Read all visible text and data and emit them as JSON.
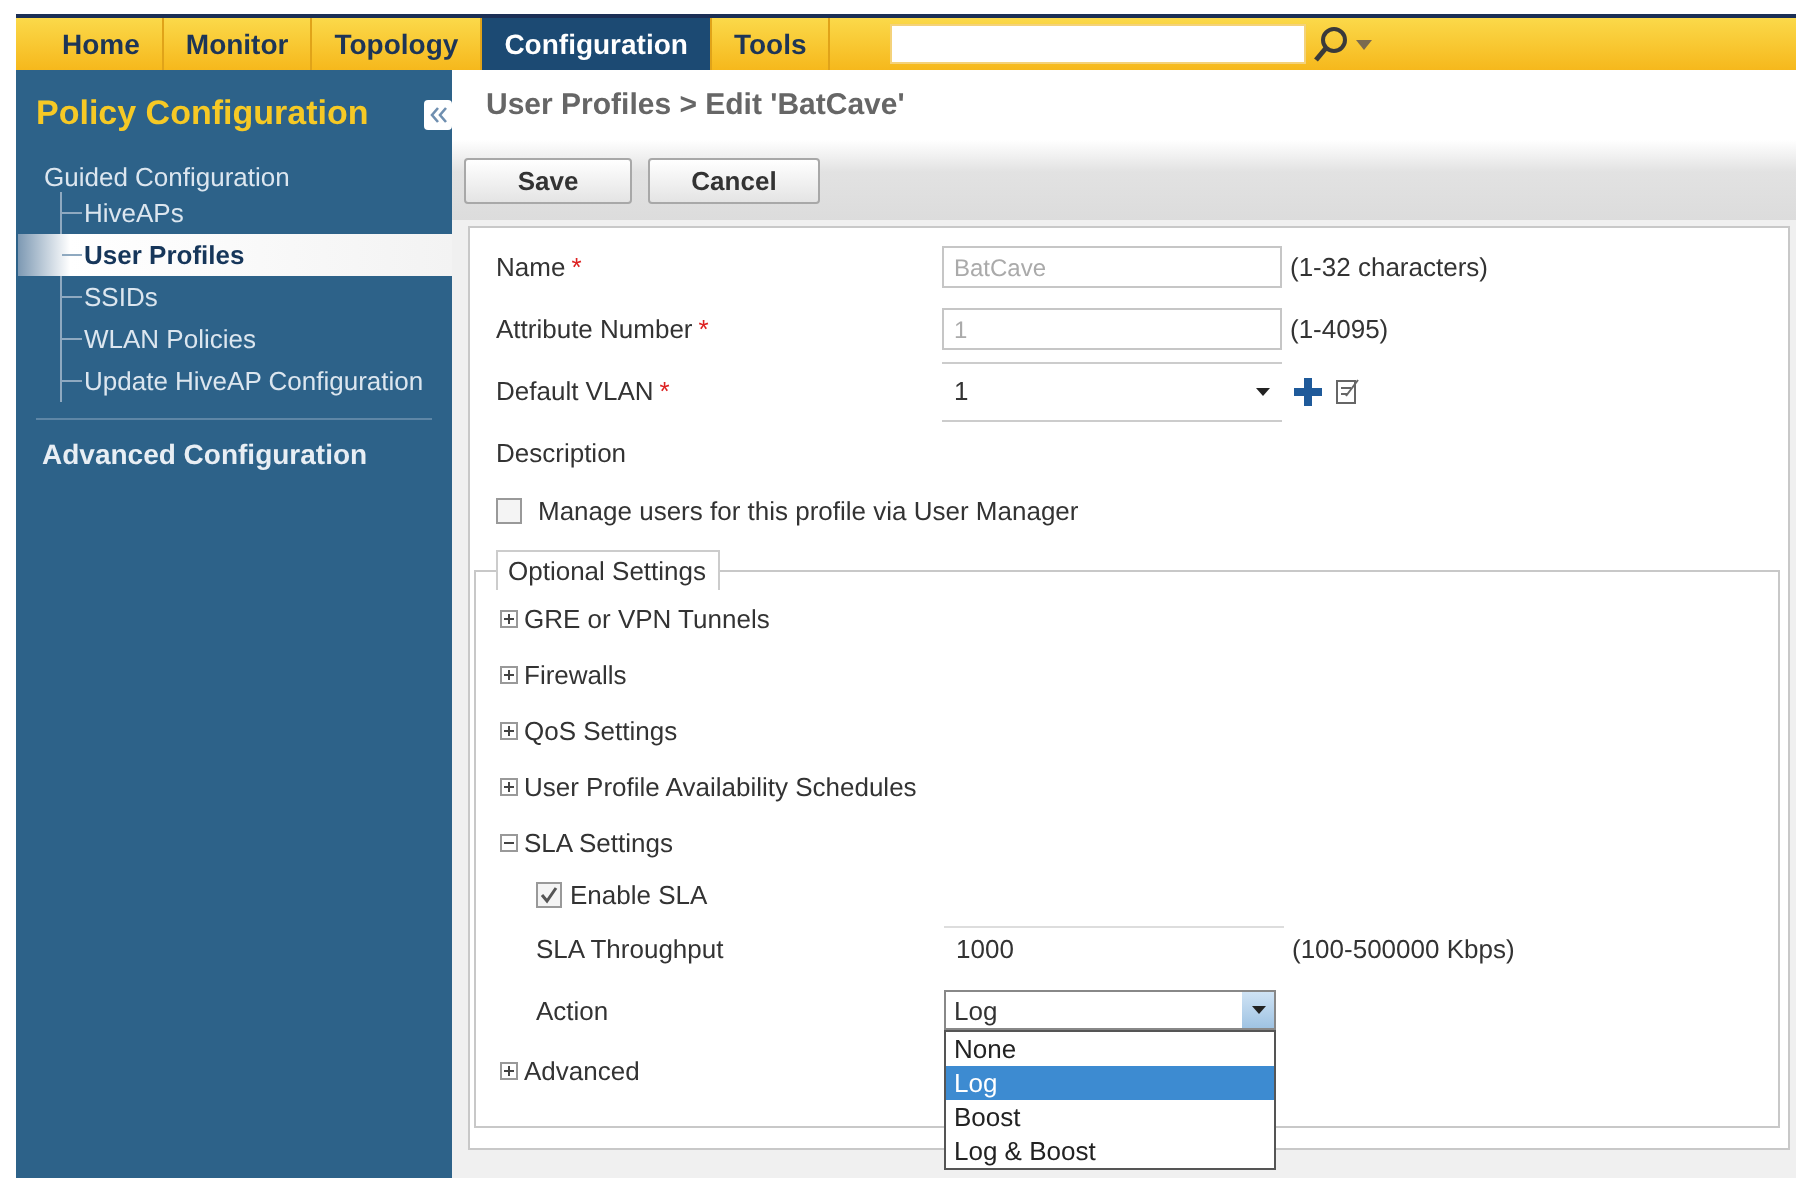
{
  "nav": {
    "tabs": [
      {
        "label": "Home",
        "selected": false
      },
      {
        "label": "Monitor",
        "selected": false
      },
      {
        "label": "Topology",
        "selected": false
      },
      {
        "label": "Configuration",
        "selected": true
      },
      {
        "label": "Tools",
        "selected": false
      }
    ]
  },
  "sidebar": {
    "title": "Policy Configuration",
    "groups": [
      {
        "label": "Guided Configuration",
        "items": [
          {
            "label": "HiveAPs",
            "selected": false
          },
          {
            "label": "User Profiles",
            "selected": true
          },
          {
            "label": "SSIDs",
            "selected": false
          },
          {
            "label": "WLAN Policies",
            "selected": false
          },
          {
            "label": "Update HiveAP Configuration",
            "selected": false
          }
        ]
      },
      {
        "label": "Advanced Configuration"
      }
    ]
  },
  "breadcrumb": "User Profiles > Edit 'BatCave'",
  "buttons": [
    "Save",
    "Cancel"
  ],
  "fields": [
    {
      "kind": "text",
      "label": "Name",
      "required_mark": "*",
      "value": "BatCave",
      "disabled": true,
      "hint": "(1-32 characters)"
    },
    {
      "kind": "text",
      "label": "Attribute Number",
      "required_mark": "*",
      "value": "1",
      "disabled": true,
      "hint": "(1-4095)"
    },
    {
      "kind": "select",
      "label": "Default VLAN",
      "required_mark": "*",
      "value": "1"
    },
    {
      "kind": "label",
      "label": "Description"
    },
    {
      "kind": "checkbox",
      "label": "Manage users for this profile via User Manager",
      "checked": false
    }
  ],
  "optional": {
    "legend": "Optional Settings",
    "sections": [
      {
        "label": "GRE or VPN Tunnels",
        "expanded": false
      },
      {
        "label": "Firewalls",
        "expanded": false
      },
      {
        "label": "QoS Settings",
        "expanded": false
      },
      {
        "label": "User Profile Availability Schedules",
        "expanded": false
      },
      {
        "label": "SLA Settings",
        "expanded": true
      },
      {
        "label": "Advanced",
        "expanded": false
      }
    ]
  },
  "sla": {
    "enable": {
      "label": "Enable SLA",
      "checked": true
    },
    "throughput": {
      "label": "SLA Throughput",
      "value": "1000",
      "hint": "(100-500000 Kbps)"
    },
    "action": {
      "label": "Action",
      "value": "Log",
      "expanded": true,
      "options": [
        {
          "label": "None",
          "selected": false
        },
        {
          "label": "Log",
          "selected": true
        },
        {
          "label": "Boost",
          "selected": false
        },
        {
          "label": "Log & Boost",
          "selected": false
        }
      ]
    }
  }
}
